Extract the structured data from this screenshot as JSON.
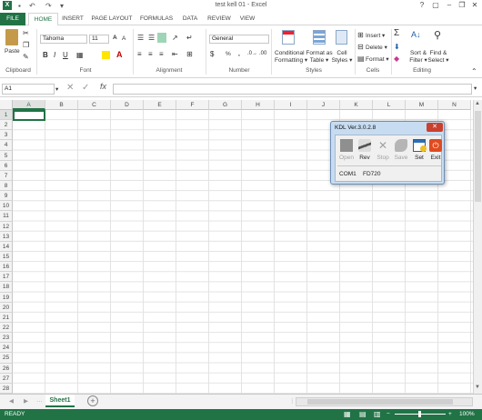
{
  "window": {
    "title": "test kell 01 - Excel",
    "help": "?",
    "restore": "▢",
    "minimize": "–",
    "maximize": "❐",
    "close": "✕"
  },
  "tabs": [
    "FILE",
    "HOME",
    "INSERT",
    "PAGE LAYOUT",
    "FORMULAS",
    "DATA",
    "REVIEW",
    "VIEW"
  ],
  "ribbon": {
    "paste": "Paste",
    "font_name": "Tahoma",
    "font_size": "11",
    "number_format": "General",
    "conditional": [
      "Conditional",
      "Formatting ▾"
    ],
    "format_table": [
      "Format as",
      "Table ▾"
    ],
    "cell_styles": [
      "Cell",
      "Styles ▾"
    ],
    "insert": "Insert ▾",
    "delete": "Delete ▾",
    "format": "Format ▾",
    "sort": [
      "Sort &",
      "Filter ▾"
    ],
    "find": [
      "Find &",
      "Select ▾"
    ],
    "groups": [
      "Clipboard",
      "Font",
      "Alignment",
      "Number",
      "Styles",
      "Cells",
      "Editing"
    ]
  },
  "formula_bar": {
    "name_box": "A1",
    "fx": "fx",
    "formula": ""
  },
  "columns": [
    "A",
    "B",
    "C",
    "D",
    "E",
    "F",
    "G",
    "H",
    "I",
    "J",
    "K",
    "L",
    "M",
    "N"
  ],
  "rows": [
    "1",
    "2",
    "3",
    "4",
    "5",
    "6",
    "7",
    "8",
    "9",
    "10",
    "11",
    "12",
    "13",
    "14",
    "15",
    "16",
    "17",
    "18",
    "19",
    "20",
    "21",
    "22",
    "23",
    "24",
    "25",
    "26",
    "27",
    "28"
  ],
  "sheets": [
    "Sheet1"
  ],
  "status": {
    "state": "READY",
    "zoom": "100%"
  },
  "kdl": {
    "title": "KDL Ver.3.0.2.8",
    "buttons": [
      {
        "label": "Open",
        "enabled": false
      },
      {
        "label": "Rev",
        "enabled": true
      },
      {
        "label": "Stop",
        "enabled": false
      },
      {
        "label": "Save",
        "enabled": false
      },
      {
        "label": "Set",
        "enabled": true
      },
      {
        "label": "Exit",
        "enabled": true
      }
    ],
    "port": "COM1",
    "device": "FD720"
  }
}
